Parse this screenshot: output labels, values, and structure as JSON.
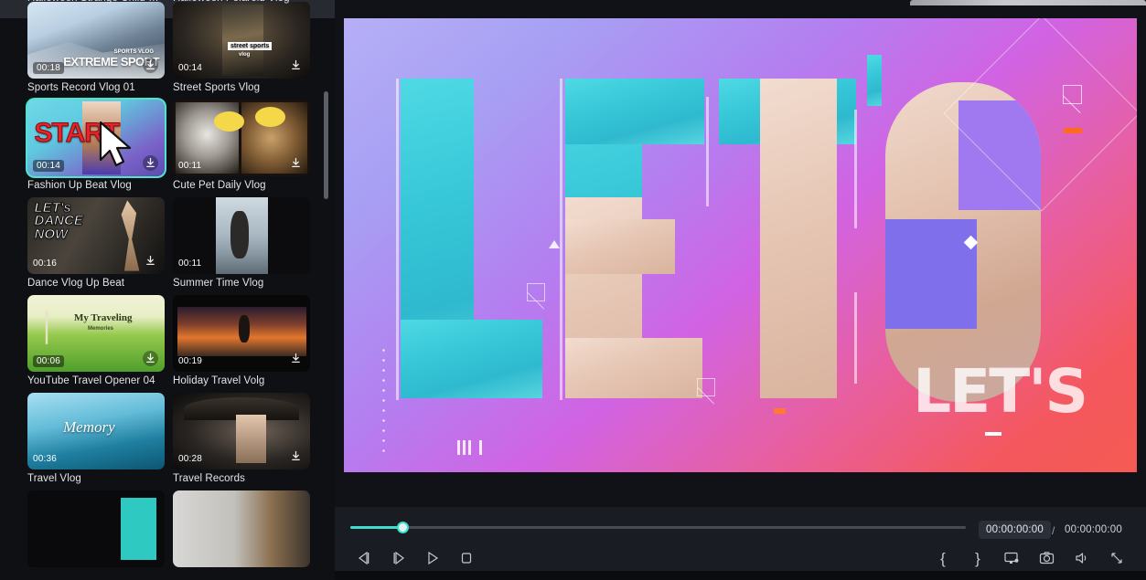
{
  "app": {
    "accent_teal": "#3fdccb",
    "panel_bg": "#0f1014",
    "topbar_bg": "#272a31",
    "transport_bg": "#191c23"
  },
  "library": {
    "more_menu_label": "More options",
    "scrollbar_label": "Library scrollbar",
    "partial_top_row": [
      {
        "title": "Halloween Strange Child Vlog"
      },
      {
        "title": "Halloween Polaroid Vlog"
      }
    ],
    "items": [
      {
        "title": "Sports Record Vlog 01",
        "duration": "00:18",
        "overlay_text": "EXTREME SPORT",
        "overlay_sub": "SPORTS VLOG",
        "selected": false,
        "art": "art-snow",
        "badge_style": "pill",
        "download": "circle"
      },
      {
        "title": "Street Sports Vlog",
        "duration": "00:14",
        "overlay_text": "street sports",
        "overlay_sub": "vlog",
        "selected": false,
        "art": "art-street",
        "badge_style": "plain",
        "download": "plain"
      },
      {
        "title": "Fashion Up Beat Vlog",
        "duration": "00:14",
        "overlay_text": "START",
        "overlay_sub": "",
        "selected": true,
        "art": "art-start",
        "badge_style": "pill",
        "download": "circle"
      },
      {
        "title": "Cute Pet Daily Vlog",
        "duration": "00:11",
        "overlay_text": "",
        "overlay_sub": "",
        "selected": false,
        "art": "art-cats",
        "badge_style": "plain",
        "download": "plain"
      },
      {
        "title": "Dance Vlog Up Beat",
        "duration": "00:16",
        "overlay_text": "LET's DANCE NOW",
        "overlay_sub": "",
        "selected": false,
        "art": "art-dance",
        "badge_style": "plain",
        "download": "plain"
      },
      {
        "title": "Summer Time Vlog",
        "duration": "00:11",
        "overlay_text": "",
        "overlay_sub": "",
        "selected": false,
        "art": "art-summer",
        "badge_style": "plain",
        "download": "none"
      },
      {
        "title": "YouTube Travel Opener 04",
        "duration": "00:06",
        "overlay_text": "My Traveling",
        "overlay_sub": "Memories",
        "selected": false,
        "art": "art-travel4",
        "badge_style": "pill",
        "download": "circle"
      },
      {
        "title": "Holiday Travel Volg",
        "duration": "00:19",
        "overlay_text": "",
        "overlay_sub": "",
        "selected": false,
        "art": "art-holiday",
        "badge_style": "plain",
        "download": "plain"
      },
      {
        "title": "Travel Vlog",
        "duration": "00:36",
        "overlay_text": "Memory",
        "overlay_sub": "",
        "selected": false,
        "art": "art-memory",
        "badge_style": "plain",
        "download": "none"
      },
      {
        "title": "Travel Records",
        "duration": "00:28",
        "overlay_text": "",
        "overlay_sub": "",
        "selected": false,
        "art": "art-records",
        "badge_style": "plain",
        "download": "plain"
      },
      {
        "title": "",
        "duration": "",
        "overlay_text": "",
        "overlay_sub": "",
        "selected": false,
        "art": "art-tealstrip",
        "badge_style": "none",
        "download": "none"
      },
      {
        "title": "",
        "duration": "",
        "overlay_text": "",
        "overlay_sub": "",
        "selected": false,
        "art": "art-gray",
        "badge_style": "none",
        "download": "none"
      }
    ]
  },
  "preview": {
    "stage_label": "Video preview",
    "big_text": "LET'S",
    "overlay_text": "LET'S",
    "gradient_start": "#b6aff6",
    "gradient_mid": "#d163e3",
    "gradient_end": "#f55a52",
    "mask_fill": "#4fd9e4"
  },
  "transport": {
    "current_timecode": "00:00:00:00",
    "separator": "/",
    "total_timecode": "00:00:00:00",
    "seek_position_percent": 8,
    "buttons_left": [
      {
        "name": "previous-frame",
        "label": "Previous frame"
      },
      {
        "name": "next-frame",
        "label": "Next frame"
      },
      {
        "name": "play",
        "label": "Play"
      },
      {
        "name": "stop",
        "label": "Stop"
      }
    ],
    "buttons_right": [
      {
        "name": "mark-in",
        "label": "{"
      },
      {
        "name": "mark-out",
        "label": "}"
      },
      {
        "name": "display-settings",
        "label": "Display"
      },
      {
        "name": "snapshot",
        "label": "Snapshot"
      },
      {
        "name": "volume",
        "label": "Volume"
      },
      {
        "name": "fullscreen",
        "label": "Fullscreen"
      }
    ]
  }
}
